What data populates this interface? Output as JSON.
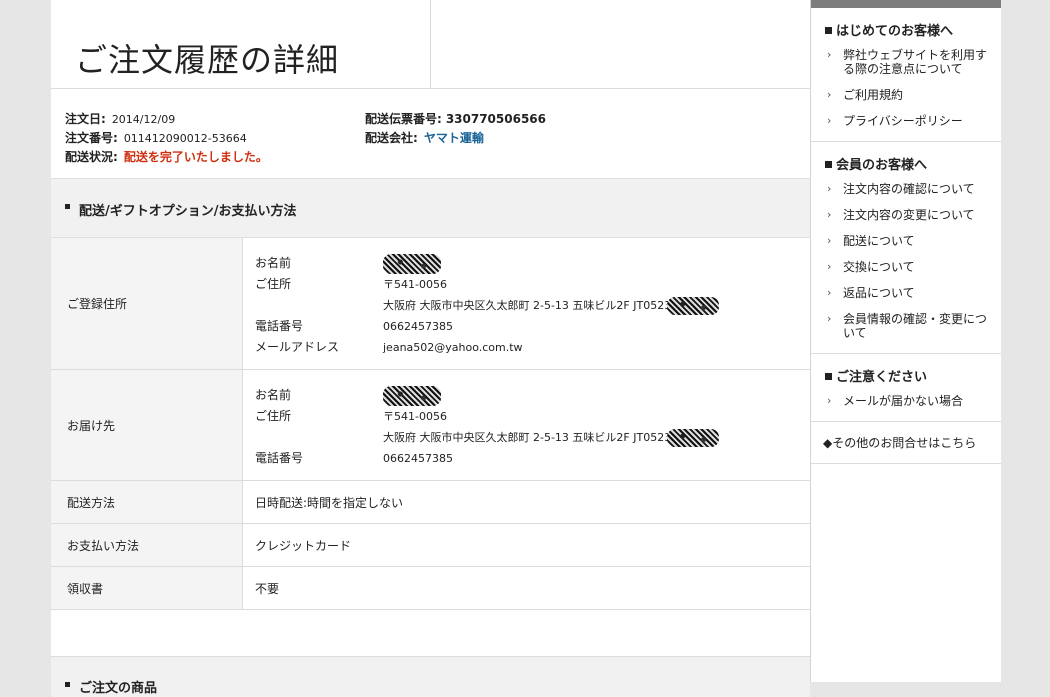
{
  "page": {
    "title": "ご注文履歴の詳細"
  },
  "order": {
    "date_label": "注文日:",
    "date_value": "2014/12/09",
    "number_label": "注文番号:",
    "number_value": "011412090012-53664",
    "status_label": "配送状況:",
    "status_value": "配送を完了いたしました。",
    "tracking_label": "配送伝票番号:",
    "tracking_value": "330770506566",
    "carrier_label": "配送会社:",
    "carrier_value": "ヤマト運輸"
  },
  "section": {
    "heading": "配送/ギフトオプション/お支払い方法"
  },
  "registered": {
    "label": "ご登録住所",
    "name_label": "お名前",
    "address_label": "ご住所",
    "postal": "〒541-0056",
    "address": "大阪府 大阪市中央区久太郎町 2-5-13 五味ビル2F JT0523",
    "phone_label": "電話番号",
    "phone": "0662457385",
    "email_label": "メールアドレス",
    "email": "jeana502@yahoo.com.tw"
  },
  "delivery": {
    "label": "お届け先",
    "name_label": "お名前",
    "address_label": "ご住所",
    "postal": "〒541-0056",
    "address": "大阪府 大阪市中央区久太郎町 2-5-13 五味ビル2F JT0523",
    "phone_label": "電話番号",
    "phone": "0662457385"
  },
  "shipping": {
    "label": "配送方法",
    "value": "日時配送:時間を指定しない"
  },
  "payment": {
    "label": "お支払い方法",
    "value": "クレジットカード"
  },
  "receipt": {
    "label": "領収書",
    "value": "不要"
  },
  "items_section": {
    "heading": "ご注文の商品"
  },
  "sidebar": {
    "first_time": {
      "heading": "はじめてのお客様へ",
      "items": [
        "弊社ウェブサイトを利用する際の注意点について",
        "ご利用規約",
        "プライバシーポリシー"
      ]
    },
    "members": {
      "heading": "会員のお客様へ",
      "items": [
        "注文内容の確認について",
        "注文内容の変更について",
        "配送について",
        "交換について",
        "返品について",
        "会員情報の確認・変更について"
      ]
    },
    "caution": {
      "heading": "ご注意ください",
      "items": [
        "メールが届かない場合"
      ]
    },
    "contact": "◆その他のお問合せはこちら"
  }
}
